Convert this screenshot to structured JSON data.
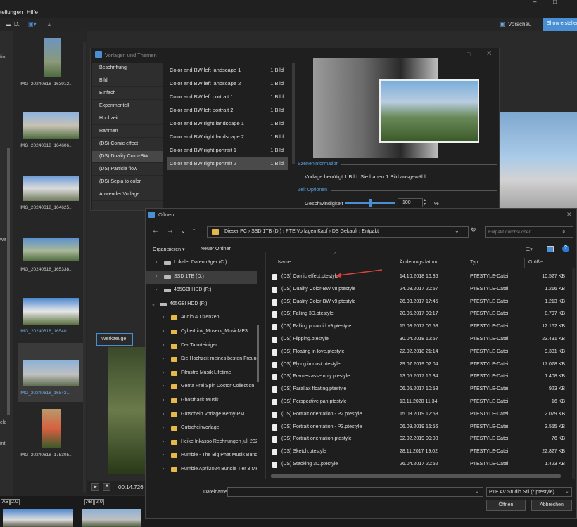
{
  "menu": {
    "item1": "tellungen",
    "item2": "Hilfe"
  },
  "toolbar": {
    "item_d": "D.",
    "vorschau": "Vorschau",
    "show_btn": "Show erstellen"
  },
  "left_edge": {
    "l1": "tio",
    "l2": "wa",
    "l3": "ele",
    "l4": "int"
  },
  "thumbnails": [
    {
      "caption": "IMG_20240618_163912..."
    },
    {
      "caption": "IMG_20240618_164606..."
    },
    {
      "caption": "IMG_20240618_164625..."
    },
    {
      "caption": "IMG_20240618_165338..."
    },
    {
      "caption": "IMG_20240618_16540..."
    },
    {
      "caption": "IMG_20240618_16542..."
    },
    {
      "caption": "IMG_20240618_175305..."
    }
  ],
  "werkzeuge": "Werkzeuge",
  "transport": {
    "time": "00:14.726"
  },
  "bottom": {
    "ab1": "AB",
    "v1": "2.0",
    "ab2": "AB",
    "v2": "2.0"
  },
  "templates_dialog": {
    "title": "Vorlagen und Themen",
    "categories": [
      "Beschriftung",
      "Bild",
      "Einfach",
      "Experimentell",
      "Hochzeit",
      "Rahmen",
      "(DS) Comic effect",
      "(DS) Duality Color-BW",
      "(DS) Particle flow",
      "(DS) Sepia to color",
      "Anwender Vorlage"
    ],
    "selected_category": 7,
    "templates": [
      {
        "name": "Color and BW left landscape 1",
        "count": "1 Bild"
      },
      {
        "name": "Color and BW left landscape 2",
        "count": "1 Bild"
      },
      {
        "name": "Color and BW left portrait 1",
        "count": "1 Bild"
      },
      {
        "name": "Color and BW left portrait 2",
        "count": "1 Bild"
      },
      {
        "name": "Color and BW right landscape 1",
        "count": "1 Bild"
      },
      {
        "name": "Color and BW right landscape 2",
        "count": "1 Bild"
      },
      {
        "name": "Color and BW right portrait 1",
        "count": "1 Bild"
      },
      {
        "name": "Color and BW right portrait 2",
        "count": "1 Bild"
      }
    ],
    "selected_template": 7,
    "scene_info_label": "Szeneninformation",
    "scene_info_text": "Vorlage benötigt 1 Bild. Sie haben 1 Bild ausgewählt",
    "time_options_label": "Zeit Optionen",
    "speed_label": "Geschwindigkeit",
    "speed_value": "100",
    "speed_unit": "%",
    "speed_fraction": 0.5
  },
  "open_dialog": {
    "title": "Öffnen",
    "path": [
      "Dieser PC",
      "SSD 1TB (D:)",
      "PTE Vorlagen Kauf",
      "DS Gekauft",
      "Entpakt"
    ],
    "path_display": "Dieser PC  ›  SSD 1TB (D:)  ›  PTE Vorlagen Kauf  ›  DS Gekauft  ›  Entpakt",
    "search_placeholder": "Entpakt durchsuchen",
    "organize": "Organisieren ▾",
    "new_folder": "Neuer Ordner",
    "columns": {
      "name": "Name",
      "date": "Änderungsdatum",
      "type": "Typ",
      "size": "Größe"
    },
    "tree": [
      {
        "label": "Lokaler Datenträger (C:)",
        "kind": "drive",
        "indent": 0
      },
      {
        "label": "SSD 1TB  (D:)",
        "kind": "drive",
        "indent": 0,
        "selected": true
      },
      {
        "label": "465GBl HDD (F:)",
        "kind": "drive",
        "indent": 0
      },
      {
        "label": "465GBl HDD (F:)",
        "kind": "drive",
        "indent": -1,
        "expanded": true
      },
      {
        "label": "Audio &  Lizenzen",
        "kind": "folder",
        "indent": 1
      },
      {
        "label": "CyberLink_Muserk_MusicMP3",
        "kind": "folder",
        "indent": 1
      },
      {
        "label": "Der Tatorteiniger",
        "kind": "folder",
        "indent": 1
      },
      {
        "label": "Die Hochzeit meines besten Freunde",
        "kind": "folder",
        "indent": 1
      },
      {
        "label": "Filmstro Musik Lifetime",
        "kind": "folder",
        "indent": 1
      },
      {
        "label": "Gema Frei Spin Doctor Collection",
        "kind": "folder",
        "indent": 1
      },
      {
        "label": "Ghosthack Musik",
        "kind": "folder",
        "indent": 1
      },
      {
        "label": "Gutschein Vorlage Berny-PM",
        "kind": "folder",
        "indent": 1
      },
      {
        "label": "Gutscheinvorlage",
        "kind": "folder",
        "indent": 1
      },
      {
        "label": "Heike Inkasso Rechnungen juli 2024",
        "kind": "folder",
        "indent": 1
      },
      {
        "label": "Humble - The Big Phat Musik Bunde",
        "kind": "folder",
        "indent": 1
      },
      {
        "label": "Humble April2024 Bundle Tier 3 MP",
        "kind": "folder",
        "indent": 1
      }
    ],
    "files": [
      {
        "name": "(DS) Comic effect.ptestyle",
        "date": "14.10.2018 16:36",
        "type": "PTESTYLE-Datei",
        "size": "10.527 KB"
      },
      {
        "name": "(DS) Duality Color-BW v8.ptestyle",
        "date": "24.03.2017 20:57",
        "type": "PTESTYLE-Datei",
        "size": "1.216 KB"
      },
      {
        "name": "(DS) Duality Color-BW v9.ptestyle",
        "date": "26.03.2017 17:45",
        "type": "PTESTYLE-Datei",
        "size": "1.213 KB"
      },
      {
        "name": "(DS) Falling 3D.ptestyle",
        "date": "20.05.2017 09:17",
        "type": "PTESTYLE-Datei",
        "size": "8.797 KB"
      },
      {
        "name": "(DS) Falling polaroid v9.ptestyle",
        "date": "15.03.2017 06:58",
        "type": "PTESTYLE-Datei",
        "size": "12.162 KB"
      },
      {
        "name": "(DS) Flipping.ptestyle",
        "date": "30.04.2018 12:57",
        "type": "PTESTYLE-Datei",
        "size": "23.431 KB"
      },
      {
        "name": "(DS) Floating in love.ptestyle",
        "date": "22.02.2018 21:14",
        "type": "PTESTYLE-Datei",
        "size": "9.331 KB"
      },
      {
        "name": "(DS) Flying in dust.ptestyle",
        "date": "29.07.2019 02:04",
        "type": "PTESTYLE-Datei",
        "size": "17.078 KB"
      },
      {
        "name": "(DS) Frames assembly.ptestyle",
        "date": "13.05.2017 16:34",
        "type": "PTESTYLE-Datei",
        "size": "1.408 KB"
      },
      {
        "name": "(DS) Parallax floating.ptestyle",
        "date": "06.05.2017 10:58",
        "type": "PTESTYLE-Datei",
        "size": "923 KB"
      },
      {
        "name": "(DS) Perspective pan.ptestyle",
        "date": "13.11.2020 11:34",
        "type": "PTESTYLE-Datei",
        "size": "16 KB"
      },
      {
        "name": "(DS) Portrait orientation - P2.ptestyle",
        "date": "15.03.2019 12:58",
        "type": "PTESTYLE-Datei",
        "size": "2.079 KB"
      },
      {
        "name": "(DS) Portrait orientation - P3.ptestyle",
        "date": "06.09.2019 16:56",
        "type": "PTESTYLE-Datei",
        "size": "3.555 KB"
      },
      {
        "name": "(DS) Portrait orientation.ptestyle",
        "date": "02.02.2019 09:08",
        "type": "PTESTYLE-Datei",
        "size": "76 KB"
      },
      {
        "name": "(DS) Sketch.ptestyle",
        "date": "28.11.2017 19:02",
        "type": "PTESTYLE-Datei",
        "size": "22.827 KB"
      },
      {
        "name": "(DS) Stacking 3D.ptestyle",
        "date": "26.04.2017 20:52",
        "type": "PTESTYLE-Datei",
        "size": "1.423 KB"
      }
    ],
    "filename_label": "Dateiname:",
    "filetype": "PTE AV Studio Stil (*.ptestyle)",
    "open_btn": "Öffnen",
    "cancel_btn": "Abbrechen"
  },
  "colors": {
    "accent": "#4a8fd4",
    "folder": "#e6b84a",
    "arrow": "#e04040"
  }
}
